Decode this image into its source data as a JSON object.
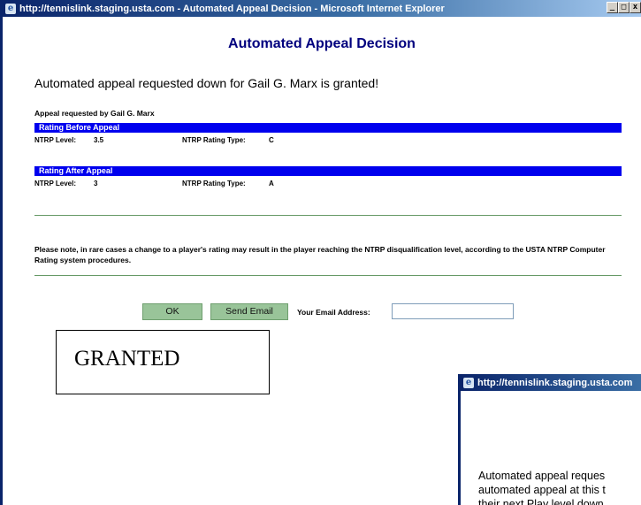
{
  "main_window": {
    "title": "http://tennislink.staging.usta.com - Automated Appeal Decision - Microsoft Internet Explorer",
    "controls": {
      "minimize": "_",
      "maximize": "□",
      "close": "x"
    }
  },
  "page": {
    "heading": "Automated Appeal Decision",
    "granted_message": "Automated appeal requested down for Gail G. Marx is granted!",
    "appeal_requested_by": "Appeal requested by Gail G. Marx",
    "before": {
      "section_title": "Rating Before Appeal",
      "ntrp_level_label": "NTRP Level:",
      "ntrp_level_value": "3.5",
      "rating_type_label": "NTRP Rating Type:",
      "rating_type_value": "C"
    },
    "after": {
      "section_title": "Rating After Appeal",
      "ntrp_level_label": "NTRP Level:",
      "ntrp_level_value": "3",
      "rating_type_label": "NTRP Rating Type:",
      "rating_type_value": "A"
    },
    "note": "Please note, in rare cases a change to a player's rating may result in the player reaching the NTRP disqualification level, according to the USTA NTRP Computer Rating system procedures.",
    "ok_button": "OK",
    "send_email_button": "Send Email",
    "email_label": "Your Email Address:",
    "email_value": ""
  },
  "annotation": {
    "granted_label": "GRANTED"
  },
  "popup_window": {
    "title": "http://tennislink.staging.usta.com",
    "text_lines": [
      "Automated appeal reques",
      "automated appeal at this t",
      "their next Play level down"
    ]
  }
}
